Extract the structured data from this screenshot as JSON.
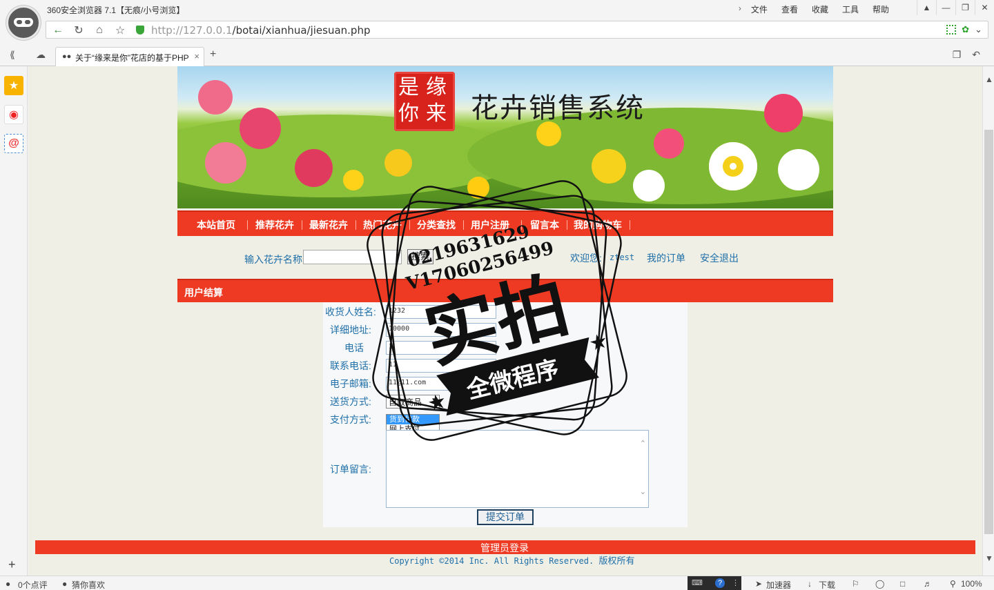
{
  "browser": {
    "title": "360安全浏览器 7.1【无痕/小号浏览】",
    "menu": [
      "文件",
      "查看",
      "收藏",
      "工具",
      "帮助"
    ],
    "url_host": "http://127.0.0.1",
    "url_path": "/botai/xianhua/jiesuan.php",
    "tab_title": "关于“缘来是你”花店的基于PHP",
    "status": {
      "comments": "0个点评",
      "guess": "猜你喜欢",
      "accelerator": "加速器",
      "download": "下载",
      "zoom": "100%"
    }
  },
  "site": {
    "logo_chars": [
      "是",
      "缘",
      "你",
      "来"
    ],
    "title": "花卉销售系统",
    "nav": [
      "本站首页",
      "推荐花卉",
      "最新花卉",
      "热门花卉",
      "分类查找",
      "用户注册",
      "留言本",
      "我的购物车"
    ],
    "search": {
      "label": "输入花卉名称",
      "value": "",
      "button": "搜索"
    },
    "user": {
      "welcome": "欢迎您:",
      "name": "ztest",
      "my_orders": "我的订单",
      "logout": "安全退出"
    },
    "section_title": "用户结算",
    "form": {
      "receiver_label": "收货人姓名:",
      "receiver_value": "1232",
      "address_label": "详细地址:",
      "address_value": "10000",
      "phone_label": "电话",
      "phone_value": "1",
      "contact_label": "联系电话:",
      "contact_value": "11",
      "email_label": "电子邮箱:",
      "email_value": "11@11.com",
      "delivery_label": "送货方式:",
      "delivery_value": "自取商品",
      "payment_label": "支付方式:",
      "payment_options": [
        "货到付款",
        "网上支付"
      ],
      "message_label": "订单留言:",
      "message_value": "",
      "submit": "提交订单"
    },
    "footer": {
      "admin_login": "管理员登录",
      "copyright": "Copyright ©2014 Inc. All Rights Reserved.",
      "rights": "版权所有"
    }
  },
  "watermark": {
    "line1": "0219631629",
    "line2": "V17060256499",
    "big": "实拍",
    "ribbon": "全微程序"
  },
  "colors": {
    "nav_red": "#ee3a22",
    "link_blue": "#1f6fa8",
    "page_bg": "#efefe6"
  }
}
